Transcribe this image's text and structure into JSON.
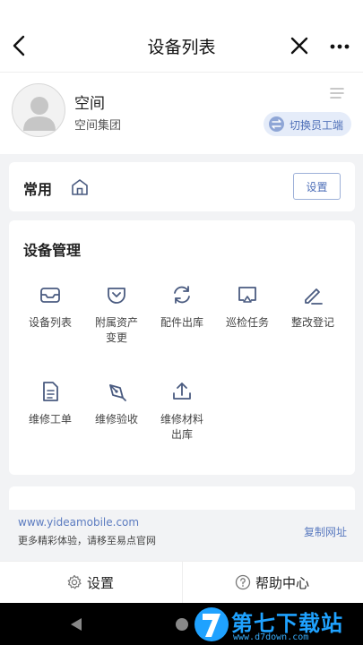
{
  "nav": {
    "title": "设备列表"
  },
  "profile": {
    "name": "空间",
    "org": "空间集团",
    "switch_label": "切换员工端"
  },
  "common": {
    "title": "常用",
    "setting_btn": "设置"
  },
  "equipment": {
    "title": "设备管理",
    "items": [
      {
        "label": "设备列表",
        "icon": "inbox-icon"
      },
      {
        "label": "附属资产变更",
        "icon": "pocket-icon"
      },
      {
        "label": "配件出库",
        "icon": "refresh-icon"
      },
      {
        "label": "巡检任务",
        "icon": "cast-icon"
      },
      {
        "label": "整改登记",
        "icon": "pen-icon"
      },
      {
        "label": "维修工单",
        "icon": "document-icon"
      },
      {
        "label": "维修验收",
        "icon": "pen-tool-icon"
      },
      {
        "label": "维修材料出库",
        "icon": "upload-icon"
      }
    ]
  },
  "footer": {
    "url": "www.yideamobile.com",
    "desc": "更多精彩体验，请移至易点官网",
    "copy_link": "复制网址"
  },
  "bottom": {
    "settings": "设置",
    "help": "帮助中心"
  },
  "watermark": {
    "title": "第七下载站",
    "url": "www.d7down.com"
  },
  "colors": {
    "accent": "#4e6fb8",
    "icon": "#4a5b80",
    "background": "#f2f3f5"
  }
}
